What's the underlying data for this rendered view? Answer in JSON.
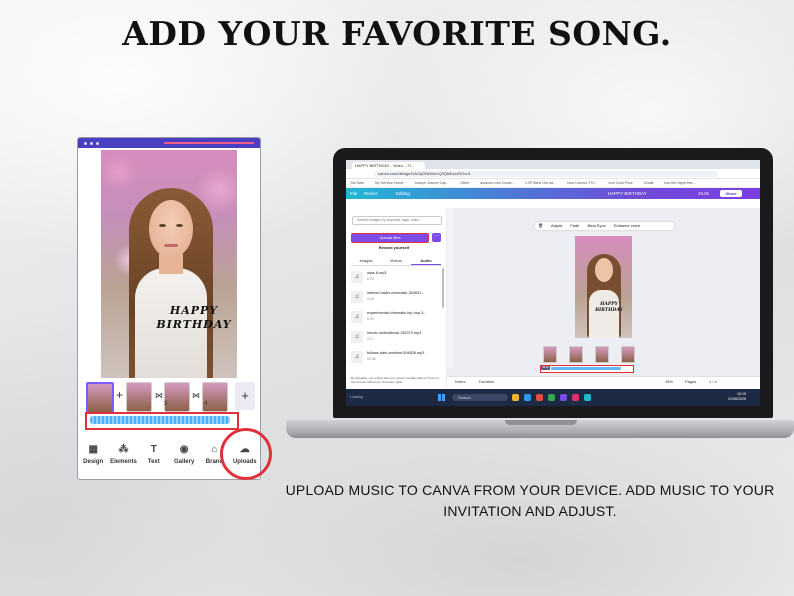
{
  "headline": "ADD YOUR FAVORITE SONG.",
  "caption_line1": "UPLOAD MUSIC TO CANVA FROM YOUR DEVICE. ADD MUSIC TO YOUR",
  "caption_line2": "INVITATION AND ADJUST.",
  "phone": {
    "design_text_line1": "HAPPY",
    "design_text_line2": "BIRTHDAY",
    "page_numbers": [
      "3",
      "4"
    ],
    "nav": [
      {
        "label": "Design",
        "icon": "design-icon"
      },
      {
        "label": "Elements",
        "icon": "elements-icon"
      },
      {
        "label": "Text",
        "icon": "text-icon"
      },
      {
        "label": "Gallery",
        "icon": "gallery-icon"
      },
      {
        "label": "Brand",
        "icon": "brand-icon"
      },
      {
        "label": "Uploads",
        "icon": "uploads-icon"
      }
    ],
    "accent": "#4a3fc2",
    "highlight": "#e0313a"
  },
  "browser": {
    "tab_title": "HAPPY BIRTHDAY - Video – Ti...",
    "address": "canva.com/design/DAGq0K8Wk/nQ5Qb8UscRGvrA",
    "bookmarks": [
      "YouTube",
      "My Service Home",
      "Joseph Joseph Cap...",
      "Other",
      "amazon.com Conta...",
      "LSP Bank Get ad...",
      "New Lenovo Y70...",
      "Live Gold Price",
      "Gmail",
      "Into the Night free..."
    ]
  },
  "canva": {
    "menu_file": "File",
    "menu_resize": "Resize",
    "menu_editing": "Editing",
    "design_title": "HAPPY BIRTHDAY",
    "share_label": "Share",
    "duration_badge": "10.0s",
    "search_placeholder": "Search images by keyword, tags, color...",
    "upload_files": "Upload files",
    "record_yourself": "Record yourself",
    "tabs": [
      "Images",
      "Videos",
      "Audio"
    ],
    "tracks": [
      {
        "name": "okss 8.mp3",
        "time": "0:25"
      },
      {
        "name": "intense-trailer-cinematic-342831...",
        "time": "0:28"
      },
      {
        "name": "experimental-cinematic-hip-hop-3...",
        "time": "0:24"
      },
      {
        "name": "heroic-motivational-195370.mp3",
        "time": "2:17"
      },
      {
        "name": "follows-dark-ambient-594826.mp3",
        "time": "00:38"
      }
    ],
    "side_note": "By uploading, you confirm that your content complies with our Terms of Use and are without any third-party rights.",
    "context_actions": [
      "Adjust",
      "Fade",
      "Beat Sync",
      "Enhance voice"
    ],
    "mini_text_line1": "HAPPY",
    "mini_text_line2": "BIRTHDAY",
    "audio_badge": "00:0s",
    "footer_notes": "Notes",
    "footer_duration": "Duration",
    "zoom": "18%",
    "pages_label": "Pages",
    "pages_count": "1 / 4"
  },
  "taskbar": {
    "search": "Search",
    "time": "10:15",
    "date": "21/06/2025",
    "left_text": "Loading"
  }
}
